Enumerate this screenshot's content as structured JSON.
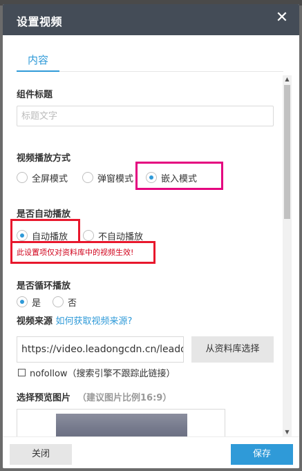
{
  "dialog": {
    "title": "设置视频",
    "close_icon": "close-icon"
  },
  "tabs": [
    {
      "label": "内容",
      "active": true
    }
  ],
  "component_title": {
    "label": "组件标题",
    "placeholder": "标题文字",
    "value": ""
  },
  "play_mode": {
    "label": "视频播放方式",
    "options": [
      "全屏模式",
      "弹窗模式",
      "嵌入模式"
    ],
    "selected": "嵌入模式"
  },
  "autoplay": {
    "label": "是否自动播放",
    "options": [
      "自动播放",
      "不自动播放"
    ],
    "selected": "自动播放",
    "note": "此设置项仅对资料库中的视频生效!"
  },
  "loop": {
    "label": "是否循环播放",
    "options": [
      "是",
      "否"
    ],
    "selected": "是"
  },
  "source": {
    "label": "视频来源",
    "help_link": "如何获取视频来源?",
    "url_value": "https://video.leadongcdn.cn/leadong",
    "library_button": "从资料库选择",
    "nofollow_label": "nofollow（搜索引擎不跟踪此链接）",
    "nofollow_checked": false
  },
  "preview": {
    "label": "选择预览图片",
    "hint": "（建议图片比例16:9）"
  },
  "footer": {
    "close_label": "关闭",
    "save_label": "保存"
  },
  "colors": {
    "header_bg": "#444c57",
    "accent": "#2f9ad8",
    "highlight_magenta": "#e4007f",
    "highlight_red": "#e8172c",
    "note_red": "#d0021b"
  }
}
